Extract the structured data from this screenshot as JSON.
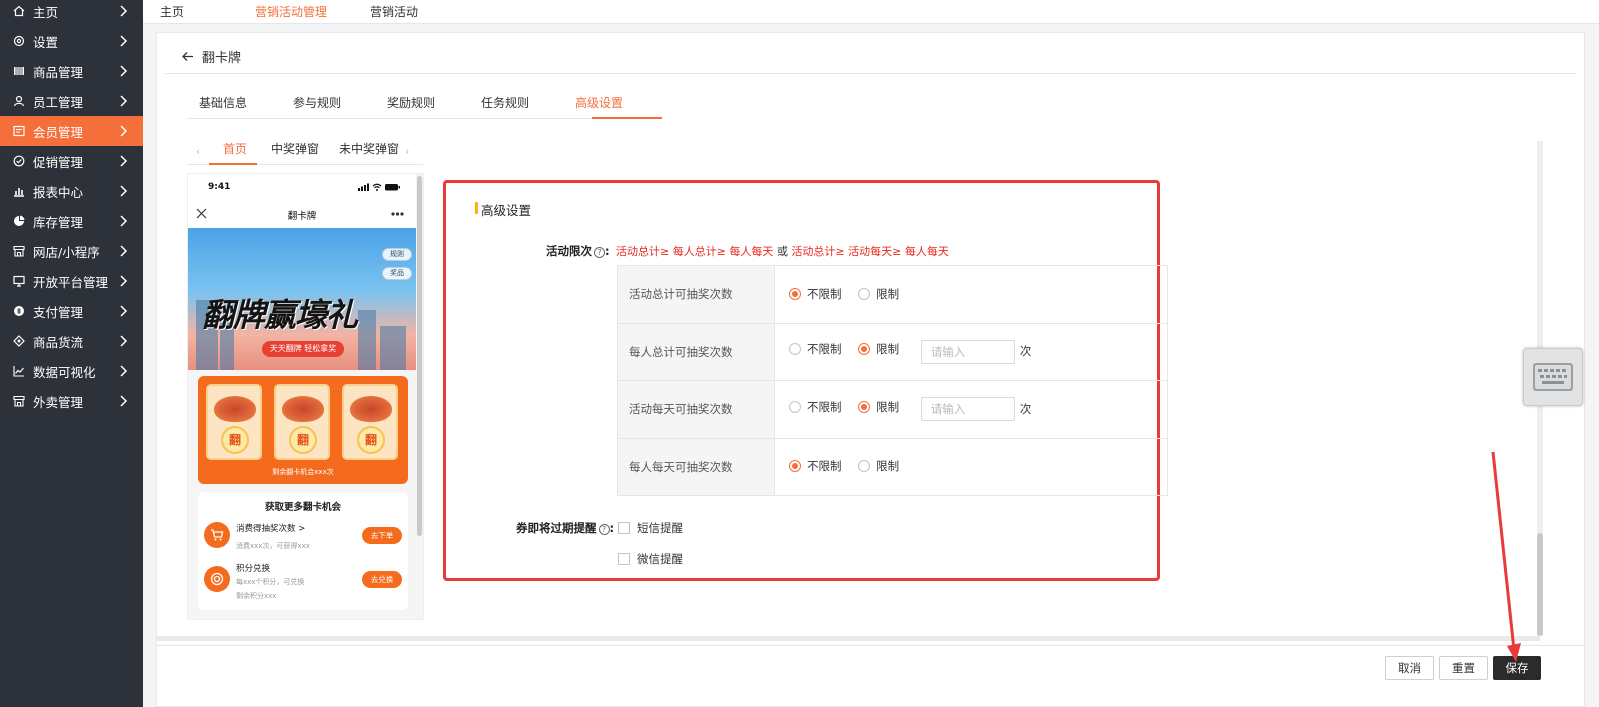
{
  "sidebar": {
    "items": [
      {
        "label": "主页",
        "icon": "home-icon"
      },
      {
        "label": "设置",
        "icon": "gear-icon"
      },
      {
        "label": "商品管理",
        "icon": "barcode-icon"
      },
      {
        "label": "员工管理",
        "icon": "user-icon"
      },
      {
        "label": "会员管理",
        "icon": "member-card-icon",
        "active": true
      },
      {
        "label": "促销管理",
        "icon": "check-circle-icon"
      },
      {
        "label": "报表中心",
        "icon": "bar-chart-icon"
      },
      {
        "label": "库存管理",
        "icon": "pie-chart-icon"
      },
      {
        "label": "网店/小程序",
        "icon": "store-icon"
      },
      {
        "label": "开放平台管理",
        "icon": "monitor-icon"
      },
      {
        "label": "支付管理",
        "icon": "coin-icon"
      },
      {
        "label": "商品货流",
        "icon": "link-icon"
      },
      {
        "label": "数据可视化",
        "icon": "line-chart-icon"
      },
      {
        "label": "外卖管理",
        "icon": "store-icon"
      }
    ]
  },
  "topnav": {
    "items": [
      {
        "label": "主页",
        "active": false
      },
      {
        "label": "营销活动管理",
        "active": true
      },
      {
        "label": "营销活动",
        "active": false
      }
    ]
  },
  "page": {
    "back_title": "翻卡牌"
  },
  "tabs": [
    "基础信息",
    "参与规则",
    "奖励规则",
    "任务规则",
    "高级设置"
  ],
  "active_tab": "高级设置",
  "preview": {
    "tabs": [
      "首页",
      "中奖弹窗",
      "未中奖弹窗"
    ],
    "active_tab": "首页",
    "phone": {
      "time": "9:41",
      "nav_title": "翻卡牌",
      "chip_rules": "规则",
      "chip_prize": "奖品",
      "hero_title": "翻牌赢壕礼",
      "hero_sub": "天天翻牌 轻松拿奖",
      "card_char": "翻",
      "remaining": "剩余翻卡机会xxx次",
      "tasks_title": "获取更多翻卡机会",
      "task1": {
        "name": "消费得抽奖次数 >",
        "desc": "消费xxx次，可获得xxx",
        "button": "去下单"
      },
      "task2": {
        "name": "积分兑换",
        "desc1": "每xxx个积分，可兑换",
        "desc2": "剩余积分xxx",
        "button": "去兑换"
      }
    }
  },
  "settings": {
    "section_title": "高级设置",
    "limit_label": "活动限次",
    "limit_colon": ":",
    "help_glyph": "?",
    "hint": {
      "part1": "活动总计≥ 每人总计≥ 每人每天",
      "or": "或",
      "part2": "活动总计≥ 活动每天≥ 每人每天"
    },
    "rows": [
      {
        "label": "活动总计可抽奖次数",
        "selected": "不限制",
        "input": false
      },
      {
        "label": "每人总计可抽奖次数",
        "selected": "限制",
        "input": true
      },
      {
        "label": "活动每天可抽奖次数",
        "selected": "限制",
        "input": true
      },
      {
        "label": "每人每天可抽奖次数",
        "selected": "不限制",
        "input": false
      }
    ],
    "opt_unlimited": "不限制",
    "opt_limited": "限制",
    "input_placeholder": "请输入",
    "unit": "次",
    "expire_label": "券即将过期提醒",
    "expire_options": [
      "短信提醒",
      "微信提醒"
    ]
  },
  "footer": {
    "cancel": "取消",
    "reset": "重置",
    "save": "保存"
  },
  "colors": {
    "accent": "#f46f3a",
    "sidebar_bg": "#2d3139",
    "highlight_box": "#e83a3a",
    "hint_red": "#e8291c"
  }
}
